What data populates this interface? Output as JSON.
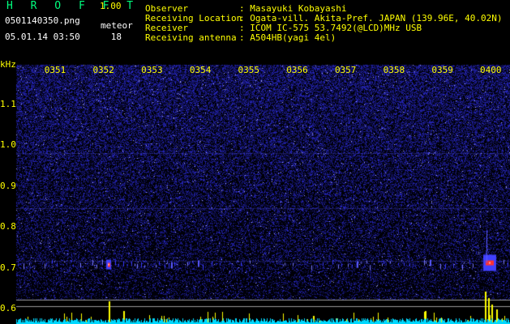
{
  "header": {
    "app_title": "HROFFT",
    "app_version": "1.00",
    "file_name": "0501140350.png",
    "timestamp": "05.01.14 03:50",
    "meteor_label": "meteor",
    "meteor_count": "18",
    "info": [
      {
        "key": "Observer",
        "value": ": Masayuki Kobayashi"
      },
      {
        "key": "Receiving Location",
        "value": ": Ogata-vill. Akita-Pref. JAPAN (139.96E, 40.02N)"
      },
      {
        "key": "Receiver",
        "value": ": ICOM IC-575 53.7492(@LCD)MHz USB"
      },
      {
        "key": "Receiving antenna",
        "value": ": A504HB(yagi 4el)"
      }
    ]
  },
  "chart_data": {
    "type": "heatmap",
    "ylabel": "kHz",
    "yticks": [
      "1.1",
      "1.0",
      "0.9",
      "0.8",
      "0.7",
      "0.6"
    ],
    "xticks": [
      "0351",
      "0352",
      "0353",
      "0354",
      "0355",
      "0356",
      "0357",
      "0358",
      "0359",
      "0400"
    ],
    "echo_band_khz": 0.71,
    "bright_echoes": [
      {
        "time": "0351.9",
        "khz": 0.7
      },
      {
        "time": "0359.8",
        "khz": 0.71
      }
    ],
    "colors": {
      "background": "#000033",
      "noise": "#2a2aff",
      "echo": "#ff3030",
      "axis": "#ffff00",
      "bottom_trace": "#00e0ff",
      "spikes": "#ffff00"
    }
  }
}
